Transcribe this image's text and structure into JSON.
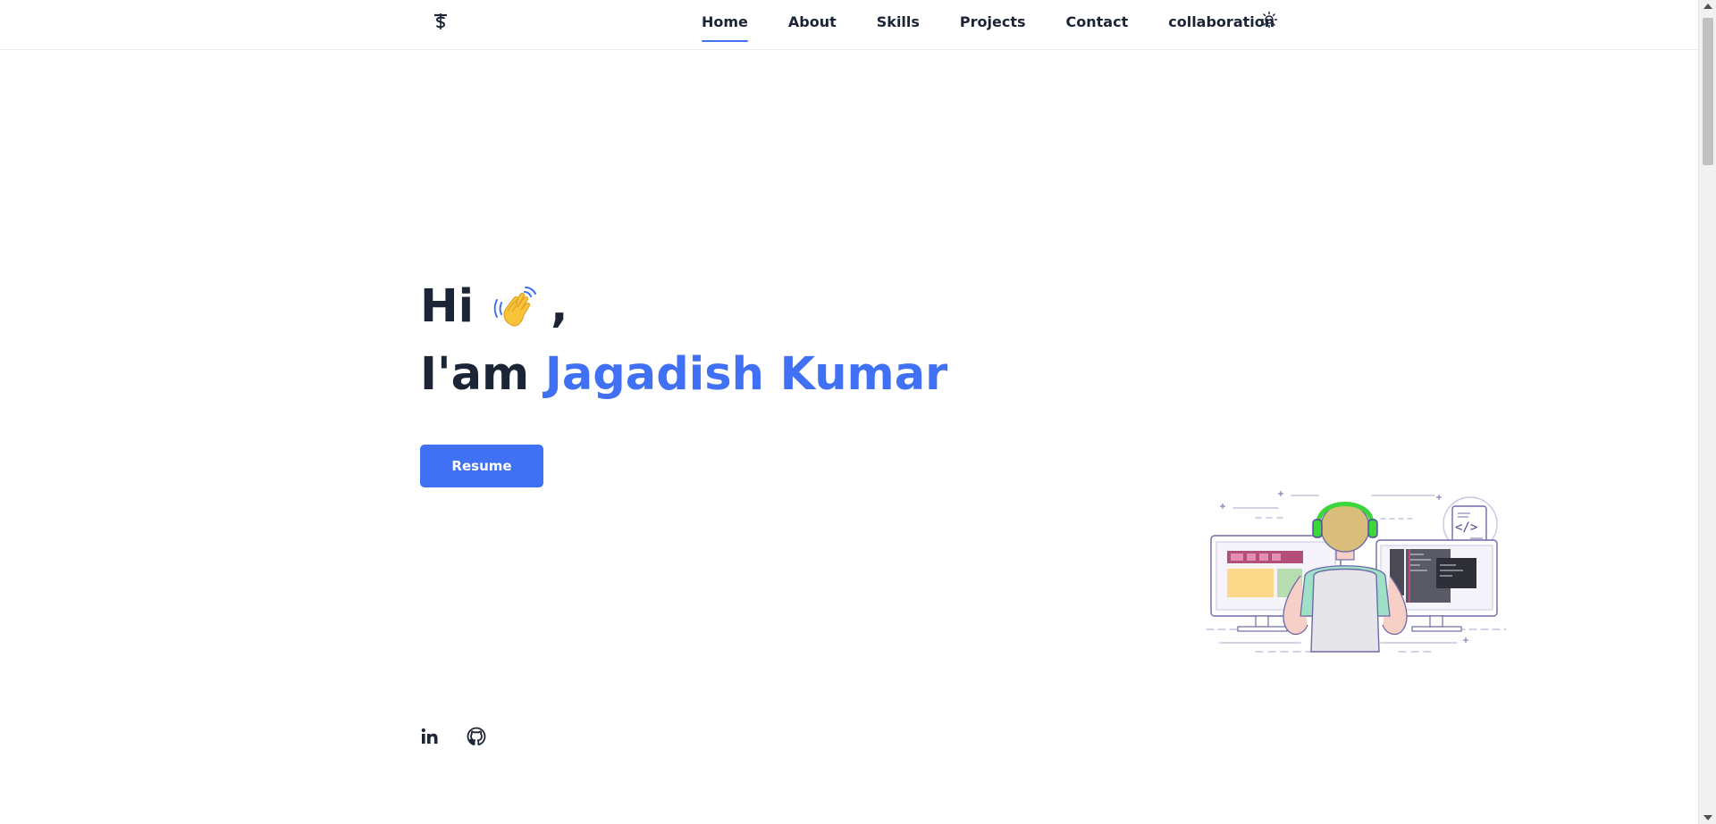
{
  "header": {
    "logo_icon": "tilde-dollar-logo-icon",
    "nav": [
      {
        "label": "Home",
        "active": true
      },
      {
        "label": "About",
        "active": false
      },
      {
        "label": "Skills",
        "active": false
      },
      {
        "label": "Projects",
        "active": false
      },
      {
        "label": "Contact",
        "active": false
      },
      {
        "label": "collaboration",
        "active": false
      }
    ],
    "theme_toggle_icon": "sun-icon"
  },
  "hero": {
    "greeting": "Hi",
    "greeting_suffix": ",",
    "wave_icon": "waving-hand-icon",
    "intro_prefix": "I'am ",
    "name": "Jagadish Kumar",
    "resume_label": "Resume"
  },
  "socials": [
    {
      "icon": "linkedin-icon"
    },
    {
      "icon": "github-icon"
    }
  ],
  "illustration": "developer-at-desk-illustration",
  "colors": {
    "accent": "#4070f4",
    "text": "#1b2536",
    "background": "#ffffff"
  }
}
